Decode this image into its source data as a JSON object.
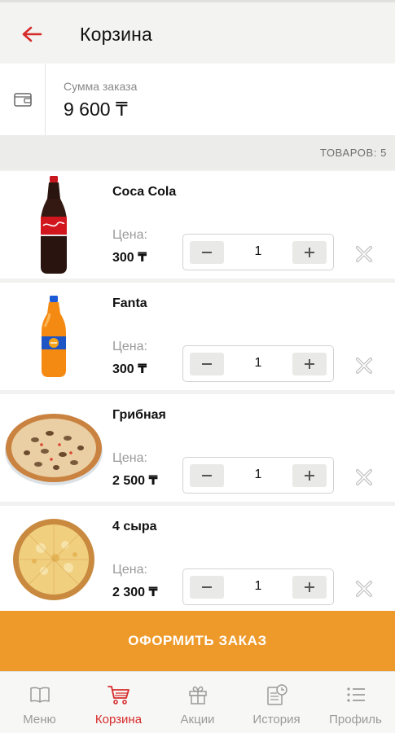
{
  "header": {
    "title": "Корзина",
    "back_icon": "arrow-left-icon",
    "accent": "#d62b2b"
  },
  "summary": {
    "label": "Сумма заказа",
    "value": "9 600 ₸",
    "icon": "wallet-icon"
  },
  "cart": {
    "count_label": "ТОВАРОВ: 5"
  },
  "items": [
    {
      "name": "Coca Cola",
      "price_label": "Цена:",
      "price": "300 ₸",
      "quantity": "1",
      "image": "coca-cola-bottle"
    },
    {
      "name": "Fanta",
      "price_label": "Цена:",
      "price": "300 ₸",
      "quantity": "1",
      "image": "fanta-bottle"
    },
    {
      "name": "Грибная",
      "price_label": "Цена:",
      "price": "2 500 ₸",
      "quantity": "1",
      "image": "mushroom-pizza"
    },
    {
      "name": "4 сыра",
      "price_label": "Цена:",
      "price": "2 300 ₸",
      "quantity": "1",
      "image": "four-cheese-pizza"
    }
  ],
  "checkout": {
    "label": "ОФОРМИТЬ ЗАКАЗ",
    "color": "#ee9a2a"
  },
  "nav": [
    {
      "label": "Меню",
      "icon": "book-icon"
    },
    {
      "label": "Корзина",
      "icon": "cart-icon",
      "active": true
    },
    {
      "label": "Акции",
      "icon": "gift-icon"
    },
    {
      "label": "История",
      "icon": "history-icon"
    },
    {
      "label": "Профиль",
      "icon": "list-icon"
    }
  ]
}
